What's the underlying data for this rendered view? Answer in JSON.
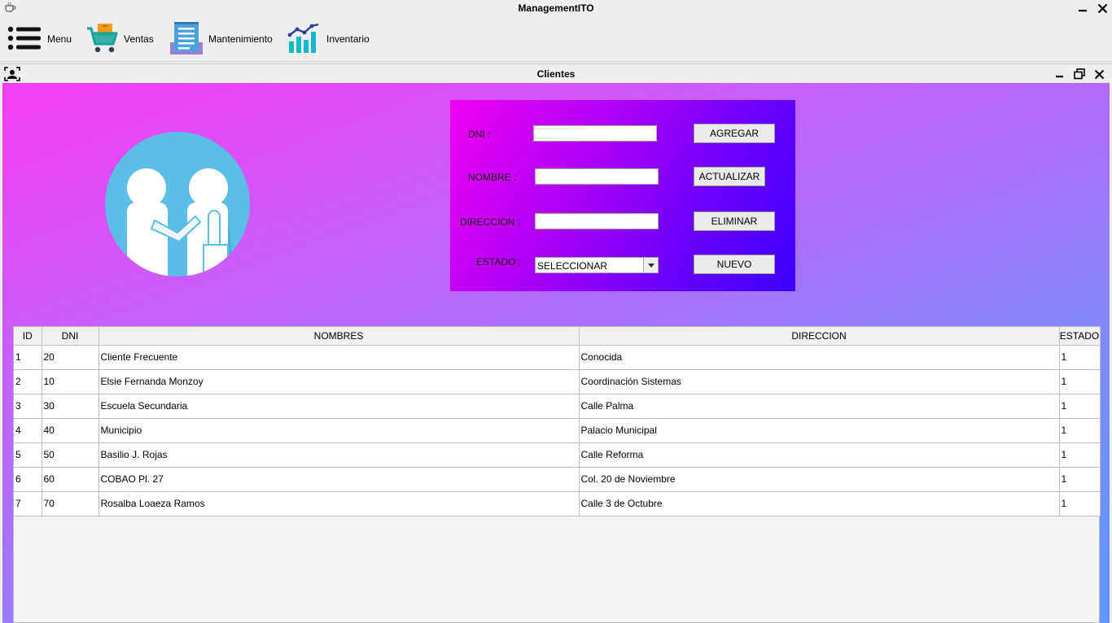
{
  "window": {
    "title": "ManagementITO"
  },
  "menubar": {
    "items": [
      {
        "label": "Menu",
        "icon": "hamburger-menu-icon"
      },
      {
        "label": "Ventas",
        "icon": "shopping-cart-icon"
      },
      {
        "label": "Mantenimiento",
        "icon": "document-list-icon"
      },
      {
        "label": "Inventario",
        "icon": "bar-chart-icon"
      }
    ]
  },
  "internal_frame": {
    "title": "Clientes"
  },
  "form": {
    "dni_label": "DNI :",
    "nombre_label": "NOMBRE :",
    "direccion_label": "DIRECCION :",
    "estado_label": "ESTADO :",
    "dni_value": "",
    "nombre_value": "",
    "direccion_value": "",
    "estado_selected": "SELECCIONAR",
    "agregar_label": "AGREGAR",
    "actualizar_label": "ACTUALIZAR",
    "eliminar_label": "ELIMINAR",
    "nuevo_label": "NUEVO"
  },
  "table": {
    "columns": [
      "ID",
      "DNI",
      "NOMBRES",
      "DIRECCION",
      "ESTADO"
    ],
    "rows": [
      [
        "1",
        "20",
        "Cliente Frecuente",
        "Conocida",
        "1"
      ],
      [
        "2",
        "10",
        "Elsie Fernanda Monzoy",
        "Coordinación Sistemas",
        "1"
      ],
      [
        "3",
        "30",
        "Escuela Secundaria",
        "Calle Palma",
        "1"
      ],
      [
        "4",
        "40",
        "Municipio",
        "Palacio Municipal",
        "1"
      ],
      [
        "5",
        "50",
        "Basilio J. Rojas",
        "Calle Reforma",
        "1"
      ],
      [
        "6",
        "60",
        "COBAO Pl. 27",
        "Col. 20 de Noviembre",
        "1"
      ],
      [
        "7",
        "70",
        "Rosalba Loaeza Ramos",
        "Calle 3 de Octubre",
        "1"
      ]
    ]
  },
  "colors": {
    "background_gradient_start": "#f53cf0",
    "background_gradient_end": "#5d96ff",
    "panel_gradient_start": "#f000f3",
    "panel_gradient_end": "#3a00ff",
    "logo_circle": "#5bbde8"
  }
}
